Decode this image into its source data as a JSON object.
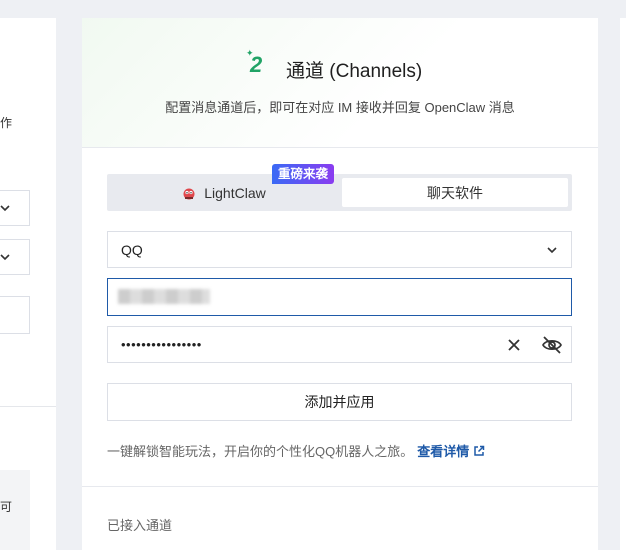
{
  "left_panel": {
    "fragment_text": "作",
    "lower_fragment": "可"
  },
  "channels": {
    "step_number": "2",
    "title": "通道 (Channels)",
    "subtitle": "配置消息通道后，即可在对应 IM 接收并回复 OpenClaw 消息",
    "tabs": [
      {
        "label": "LightClaw",
        "icon": "lightclaw-icon",
        "selected": false
      },
      {
        "label": "聊天软件",
        "selected": true
      }
    ],
    "badge": "重磅来袭",
    "channel_select": {
      "value": "QQ"
    },
    "app_id_input": {
      "value": ""
    },
    "secret_input": {
      "value": "••••••••••••••••"
    },
    "add_button": "添加并应用",
    "hint_text": "一键解锁智能玩法，开启你的个性化QQ机器人之旅。",
    "hint_link": "查看详情",
    "connected_label": "已接入通道"
  },
  "colors": {
    "accent_green": "#21a366",
    "link_blue": "#1f5aa8",
    "badge_start": "#3a6af5",
    "badge_end": "#8a3cf0"
  }
}
